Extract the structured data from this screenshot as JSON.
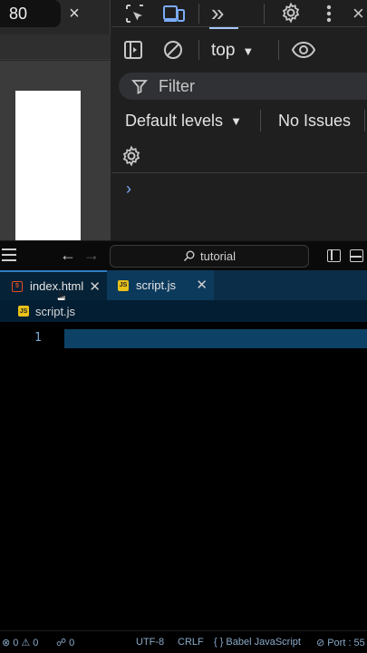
{
  "browser": {
    "zoom_value": "80",
    "close_symbol": "×"
  },
  "devtools": {
    "context": "top",
    "filter_label": "Filter",
    "levels_label": "Default levels",
    "issues_label": "No Issues",
    "more_tabs_symbol": "»",
    "prompt_symbol": "›"
  },
  "vscode": {
    "search_text": "tutorial",
    "tabs": [
      {
        "label": "index.html",
        "icon": "html5-icon",
        "icon_text": "5",
        "active": true
      },
      {
        "label": "script.js",
        "icon": "js-file-icon",
        "icon_text": "JS",
        "active": false
      }
    ],
    "breadcrumb": {
      "icon_text": "JS",
      "label": "script.js"
    },
    "editor": {
      "line_numbers": [
        "1"
      ]
    },
    "status": {
      "errors": "0",
      "warnings": "0",
      "ports": "0",
      "encoding": "UTF-8",
      "eol": "CRLF",
      "language": "Babel JavaScript",
      "port": "Port : 55"
    }
  },
  "colors": {
    "tab_bar": "#0c2d47",
    "active_tab_border": "#2d7fc4",
    "current_line": "#0d4266",
    "devtools_bg": "#1f1f1f"
  }
}
